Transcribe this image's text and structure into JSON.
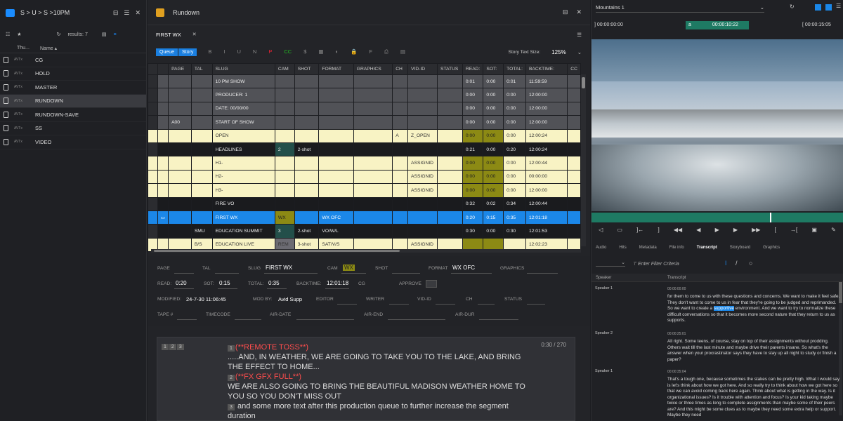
{
  "left": {
    "crumbs": "S > U > S >10PM",
    "results": "results: 7",
    "col_thumb": "Thu...",
    "col_name": "Name ▴",
    "items": [
      {
        "name": "CG"
      },
      {
        "name": "HOLD"
      },
      {
        "name": "MASTER"
      },
      {
        "name": "RUNDOWN"
      },
      {
        "name": "RUNDOWN-SAVE"
      },
      {
        "name": "SS"
      },
      {
        "name": "VIDEO"
      }
    ],
    "thumb_label": "AVTx"
  },
  "mid": {
    "title": "Rundown",
    "tab": "FIRST WX",
    "queue": "Queue",
    "story": "Story",
    "story_text_size_label": "Story Text Size:",
    "story_text_size": "125%",
    "tool_glyphs": [
      "B",
      "I",
      "U",
      "N",
      "P",
      "CC",
      "$",
      "▦",
      "◐",
      "🔒",
      "F",
      "⎙",
      "▤"
    ],
    "cols": [
      "",
      "",
      "PAGE",
      "TAL",
      "SLUG",
      "CAM",
      "SHOT",
      "FORMAT",
      "GRAPHICS",
      "CH",
      "VID-ID",
      "STATUS",
      "READ:",
      "SOT:",
      "TOTAL:",
      "BACKTIME:",
      "CC"
    ],
    "rows": [
      {
        "t": "g",
        "c": [
          "",
          "",
          "",
          "",
          "10 PM SHOW",
          "",
          "",
          "",
          "",
          "",
          "",
          "",
          "0:01",
          "0:00",
          "0:01",
          "11:59:59",
          ""
        ]
      },
      {
        "t": "g",
        "c": [
          "",
          "",
          "",
          "",
          "PRODUCER: 1",
          "",
          "",
          "",
          "",
          "",
          "",
          "",
          "0:00",
          "0:00",
          "0:00",
          "12:00:00",
          ""
        ]
      },
      {
        "t": "g",
        "c": [
          "",
          "",
          "",
          "",
          "DATE: 00/00/00",
          "",
          "",
          "",
          "",
          "",
          "",
          "",
          "0:00",
          "0:00",
          "0:00",
          "12:00:00",
          ""
        ]
      },
      {
        "t": "g",
        "c": [
          "",
          "",
          "A00",
          "",
          "START OF SHOW",
          "",
          "",
          "",
          "",
          "",
          "",
          "",
          "0:00",
          "0:00",
          "0:00",
          "12:00:00",
          ""
        ]
      },
      {
        "t": "y",
        "c": [
          "",
          "",
          "",
          "",
          "OPEN",
          "",
          "",
          "",
          "",
          "A",
          "Z_OPEN",
          "",
          "0:00",
          "0:00",
          "0:00",
          "12:00:24",
          ""
        ]
      },
      {
        "t": "k",
        "c": [
          "",
          "",
          "",
          "",
          "HEADLINES",
          "2",
          "2-shot",
          "",
          "",
          "",
          "",
          "",
          "0:21",
          "0:00",
          "0:20",
          "12:00:24",
          ""
        ]
      },
      {
        "t": "y",
        "c": [
          "",
          "",
          "",
          "",
          "H1-",
          "",
          "",
          "",
          "",
          "",
          "ASSIGNID",
          "",
          "0:00",
          "0:00",
          "0:00",
          "12:00:44",
          ""
        ]
      },
      {
        "t": "y",
        "c": [
          "",
          "",
          "",
          "",
          "H2-",
          "",
          "",
          "",
          "",
          "",
          "ASSIGNID",
          "",
          "0:00",
          "0:00",
          "0:00",
          "00:00:00",
          ""
        ]
      },
      {
        "t": "y",
        "c": [
          "",
          "",
          "",
          "",
          "H3-",
          "",
          "",
          "",
          "",
          "",
          "ASSIGNID",
          "",
          "0:00",
          "0:00",
          "0:00",
          "12:00:00",
          ""
        ]
      },
      {
        "t": "k",
        "c": [
          "",
          "",
          "",
          "",
          "FIRE VO",
          "",
          "",
          "",
          "",
          "",
          "",
          "",
          "0:32",
          "0:02",
          "0:34",
          "12:00:44",
          ""
        ]
      },
      {
        "t": "b",
        "c": [
          "",
          "▭",
          "",
          "",
          "FIRST WX",
          "WX",
          "",
          "WX OFC",
          "",
          "",
          "",
          "",
          "0:20",
          "0:15",
          "0:35",
          "12:01:18",
          ""
        ]
      },
      {
        "t": "k",
        "c": [
          "",
          "",
          "",
          "SMU",
          "EDUCATION SUMMIT",
          "3",
          "2-shot",
          "VO/W/L",
          "",
          "",
          "",
          "",
          "0:30",
          "0:00",
          "0:30",
          "12:01:53",
          ""
        ]
      },
      {
        "t": "y",
        "c": [
          "",
          "",
          "",
          "B/S",
          "EDUCATION LIVE",
          "REM",
          "3-shot",
          "SAT/V/S",
          "",
          "",
          "ASSIGNID",
          "",
          "",
          "",
          "",
          "12:02:23",
          ""
        ]
      }
    ],
    "form": {
      "page": "PAGE",
      "tal": "TAL",
      "slug_l": "SLUG",
      "slug": "FIRST WX",
      "cam_l": "CAM",
      "cam": "WX",
      "shot": "SHOT",
      "format_l": "FORMAT",
      "format": "WX OFC",
      "graphics": "GRAPHICS",
      "read_l": "READ:",
      "read": "0:20",
      "sot_l": "SOT:",
      "sot": "0:15",
      "total_l": "TOTAL:",
      "total": "0:35",
      "back_l": "BACKTIME:",
      "back": "12:01:18",
      "cg": "CG",
      "approve": "APPROVE",
      "mod_l": "MODIFIED:",
      "mod": "24-7-30 11:06:45",
      "modby_l": "MOD BY:",
      "modby": "Avid Supp",
      "editor": "EDITOR",
      "writer": "WRITER",
      "vidid": "VID-ID",
      "ch": "CH",
      "status": "STATUS",
      "tape": "TAPE #",
      "timecode": "TIMECODE",
      "airdate": "AIR-DATE",
      "airend": "AIR-END",
      "airdur": "AIR-DUR"
    },
    "script": {
      "tabs": [
        "1",
        "2",
        "3"
      ],
      "time": "0:30 / 270",
      "l1": "(**REMOTE TOSS**)",
      "l2": ".....AND, IN WEATHER, WE ARE GOING TO TAKE YOU TO THE LAKE, AND BRING",
      "l3": "THE EFFECT TO HOME...",
      "l4": "(**FX GFX FULL**)",
      "l5": "WE ARE ALSO GOING TO BRING THE BEAUTIFUL MADISON WEATHER HOME TO",
      "l6": "YOU SO YOU DON'T MISS OUT",
      "l7": " and some more text after this production queue to further increase the segment",
      "l8": "duration"
    }
  },
  "right": {
    "clip": "Mountains 1",
    "tc_in": "00:00:00:00",
    "tc_mid": "00:00:10:22",
    "tc_out": "00:00:15:05",
    "tc_a": "a",
    "tabs": [
      "Audio",
      "Hits",
      "Metadata",
      "File info",
      "Transcript",
      "Storyboard",
      "Graphics"
    ],
    "filter": "Enter Filter Criteria",
    "col_speaker": "Speaker",
    "col_transcript": "Transcript",
    "entries": [
      {
        "speaker": "Speaker 1",
        "time": "00:00:00:00",
        "text_pre": "for them to come to us with these questions and concerns. We want to make it feel safe. They don't want to come to us in fear that they're going to be judged and reprimanded. So we want to create a ",
        "hl": "supportive",
        "text_post": " environment. And we want to try to normalize these difficult conversations so that it becomes more second nature that they return to us as supports."
      },
      {
        "speaker": "Speaker 2",
        "time": "00:00:25:01",
        "text_pre": "All right. Some teens, of course, stay on top of their assignments without prodding. Others wait till the last minute and maybe drive their parents insane. So what's the answer when your procrastinator says they have to stay up all night to study or finish a paper?",
        "hl": "",
        "text_post": ""
      },
      {
        "speaker": "Speaker 1",
        "time": "00:00:35:04",
        "text_pre": "That's a tough one, because sometimes the stakes can be pretty high. What I would say is let's think about how we got here. And so really try to think about how we got here so that we can avoid coming back here again. Think about what is getting in the way. Is it organizational issues? Is it trouble with attention and focus? Is your kid taking maybe twice or three times as long to complete assignments than maybe some of their peers are? And this might be some clues as to maybe they need some extra help or support. Maybe they need",
        "hl": "",
        "text_post": ""
      }
    ]
  }
}
